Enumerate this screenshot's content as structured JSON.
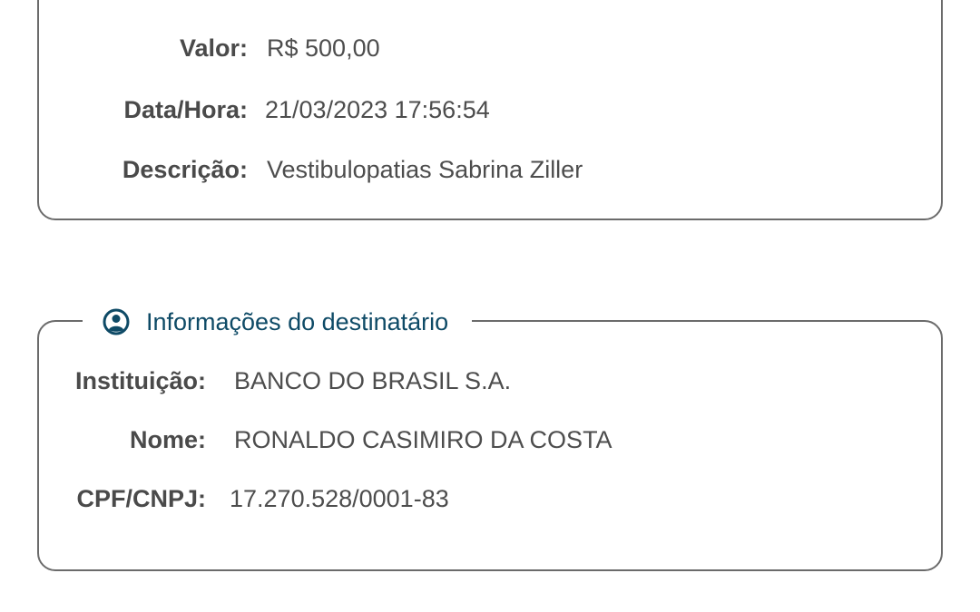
{
  "transaction": {
    "rows": [
      {
        "label": "Valor:",
        "value": "R$ 500,00"
      },
      {
        "label": "Data/Hora:",
        "value": "21/03/2023 17:56:54"
      },
      {
        "label": "Descrição:",
        "value": "Vestibulopatias Sabrina Ziller"
      }
    ]
  },
  "recipient": {
    "title": "Informações do destinatário",
    "icon": "user-circle-icon",
    "accent_color": "#0e4a66",
    "rows": [
      {
        "label": "Instituição:",
        "value": "BANCO DO BRASIL S.A."
      },
      {
        "label": "Nome:",
        "value": "RONALDO CASIMIRO DA COSTA"
      },
      {
        "label": "CPF/CNPJ:",
        "value": "17.270.528/0001-83"
      }
    ]
  }
}
